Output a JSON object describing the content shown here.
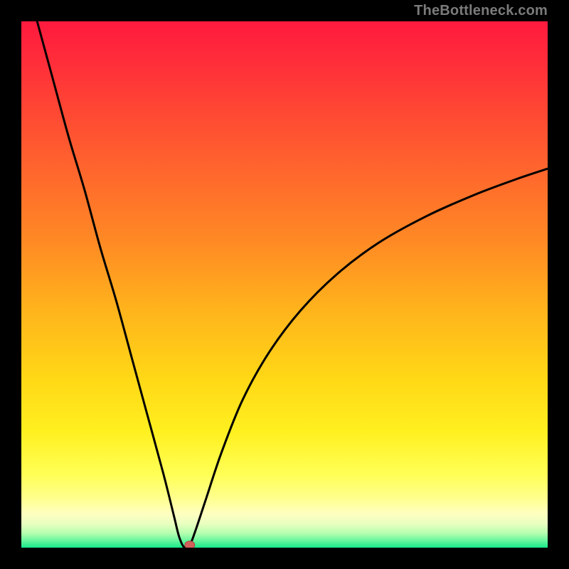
{
  "watermark": "TheBottleneck.com",
  "colors": {
    "frame": "#000000",
    "curve": "#000000",
    "marker_fill": "#d2605b",
    "marker_stroke": "#a94840",
    "gradient_stops": [
      {
        "offset": 0.0,
        "color": "#ff1a3e"
      },
      {
        "offset": 0.08,
        "color": "#ff2e3a"
      },
      {
        "offset": 0.18,
        "color": "#ff4a33"
      },
      {
        "offset": 0.3,
        "color": "#ff6a2c"
      },
      {
        "offset": 0.42,
        "color": "#ff8a24"
      },
      {
        "offset": 0.55,
        "color": "#ffb41c"
      },
      {
        "offset": 0.68,
        "color": "#ffd816"
      },
      {
        "offset": 0.78,
        "color": "#fff020"
      },
      {
        "offset": 0.86,
        "color": "#ffff55"
      },
      {
        "offset": 0.905,
        "color": "#ffff8c"
      },
      {
        "offset": 0.935,
        "color": "#ffffc0"
      },
      {
        "offset": 0.955,
        "color": "#e8ffc0"
      },
      {
        "offset": 0.972,
        "color": "#b8ffb0"
      },
      {
        "offset": 0.985,
        "color": "#70f8a0"
      },
      {
        "offset": 1.0,
        "color": "#18e88a"
      }
    ]
  },
  "chart_data": {
    "type": "line",
    "title": "",
    "xlabel": "",
    "ylabel": "",
    "xlim": [
      0,
      100
    ],
    "ylim": [
      0,
      100
    ],
    "minimum": {
      "x": 31,
      "y": 0
    },
    "series": [
      {
        "name": "curve",
        "x": [
          3,
          6,
          9,
          12,
          15,
          18,
          21,
          24,
          27,
          29,
          30,
          31,
          32,
          33,
          35,
          38,
          42,
          47,
          53,
          60,
          68,
          77,
          86,
          94,
          100
        ],
        "y": [
          100,
          89,
          78,
          68,
          57,
          47,
          36,
          25,
          14,
          6,
          2,
          0,
          0.5,
          3,
          9,
          18,
          28,
          37,
          45,
          52,
          58,
          63,
          67,
          70,
          72
        ]
      }
    ],
    "marker": {
      "x": 32,
      "y": 0.5
    }
  }
}
